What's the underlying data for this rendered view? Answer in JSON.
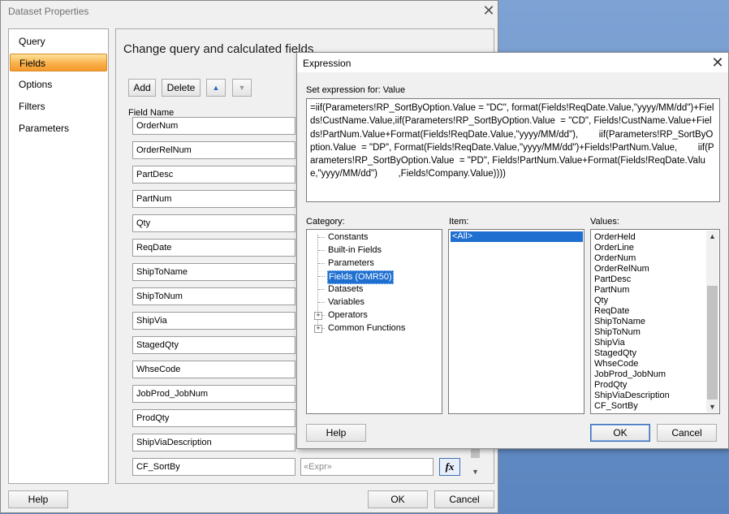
{
  "dataset_dialog": {
    "title": "Dataset Properties",
    "close_glyph": "✕",
    "nav_items": [
      {
        "label": "Query",
        "selected": false
      },
      {
        "label": "Fields",
        "selected": true
      },
      {
        "label": "Options",
        "selected": false
      },
      {
        "label": "Filters",
        "selected": false
      },
      {
        "label": "Parameters",
        "selected": false
      }
    ],
    "panel_title": "Change query and calculated fields",
    "add_label": "Add",
    "delete_label": "Delete",
    "up_glyph": "▲",
    "down_glyph": "▼",
    "field_name_header": "Field Name",
    "fields": [
      "OrderNum",
      "OrderRelNum",
      "PartDesc",
      "PartNum",
      "Qty",
      "ReqDate",
      "ShipToName",
      "ShipToNum",
      "ShipVia",
      "StagedQty",
      "WhseCode",
      "JobProd_JobNum",
      "ProdQty",
      "ShipViaDescription"
    ],
    "calc_field_name": "CF_SortBy",
    "calc_field_expr": "«Expr»",
    "fx_label": "fx",
    "help_label": "Help",
    "ok_label": "OK",
    "cancel_label": "Cancel"
  },
  "expression_dialog": {
    "title": "Expression",
    "close_glyph": "✕",
    "set_expression_label": "Set expression for: Value",
    "expression": "=iif(Parameters!RP_SortByOption.Value = \"DC\", format(Fields!ReqDate.Value,\"yyyy/MM/dd\")+Fields!CustName.Value,iif(Parameters!RP_SortByOption.Value  = \"CD\", Fields!CustName.Value+Fields!PartNum.Value+Format(Fields!ReqDate.Value,\"yyyy/MM/dd\"),        iif(Parameters!RP_SortByOption.Value  = \"DP\", Format(Fields!ReqDate.Value,\"yyyy/MM/dd\")+Fields!PartNum.Value,        iif(Parameters!RP_SortByOption.Value  = \"PD\", Fields!PartNum.Value+Format(Fields!ReqDate.Value,\"yyyy/MM/dd\")        ,Fields!Company.Value))))",
    "category_label": "Category:",
    "item_label": "Item:",
    "values_label": "Values:",
    "categories": [
      {
        "label": "Constants",
        "expandable": false,
        "selected": false
      },
      {
        "label": "Built-in Fields",
        "expandable": false,
        "selected": false
      },
      {
        "label": "Parameters",
        "expandable": false,
        "selected": false
      },
      {
        "label": "Fields (OMR50)",
        "expandable": false,
        "selected": true
      },
      {
        "label": "Datasets",
        "expandable": false,
        "selected": false
      },
      {
        "label": "Variables",
        "expandable": false,
        "selected": false
      },
      {
        "label": "Operators",
        "expandable": true,
        "selected": false
      },
      {
        "label": "Common Functions",
        "expandable": true,
        "selected": false
      }
    ],
    "items": [
      "<All>"
    ],
    "values": [
      "OrderHeld",
      "OrderLine",
      "OrderNum",
      "OrderRelNum",
      "PartDesc",
      "PartNum",
      "Qty",
      "ReqDate",
      "ShipToName",
      "ShipToNum",
      "ShipVia",
      "StagedQty",
      "WhseCode",
      "JobProd_JobNum",
      "ProdQty",
      "ShipViaDescription",
      "CF_SortBy"
    ],
    "help_label": "Help",
    "ok_label": "OK",
    "cancel_label": "Cancel"
  }
}
